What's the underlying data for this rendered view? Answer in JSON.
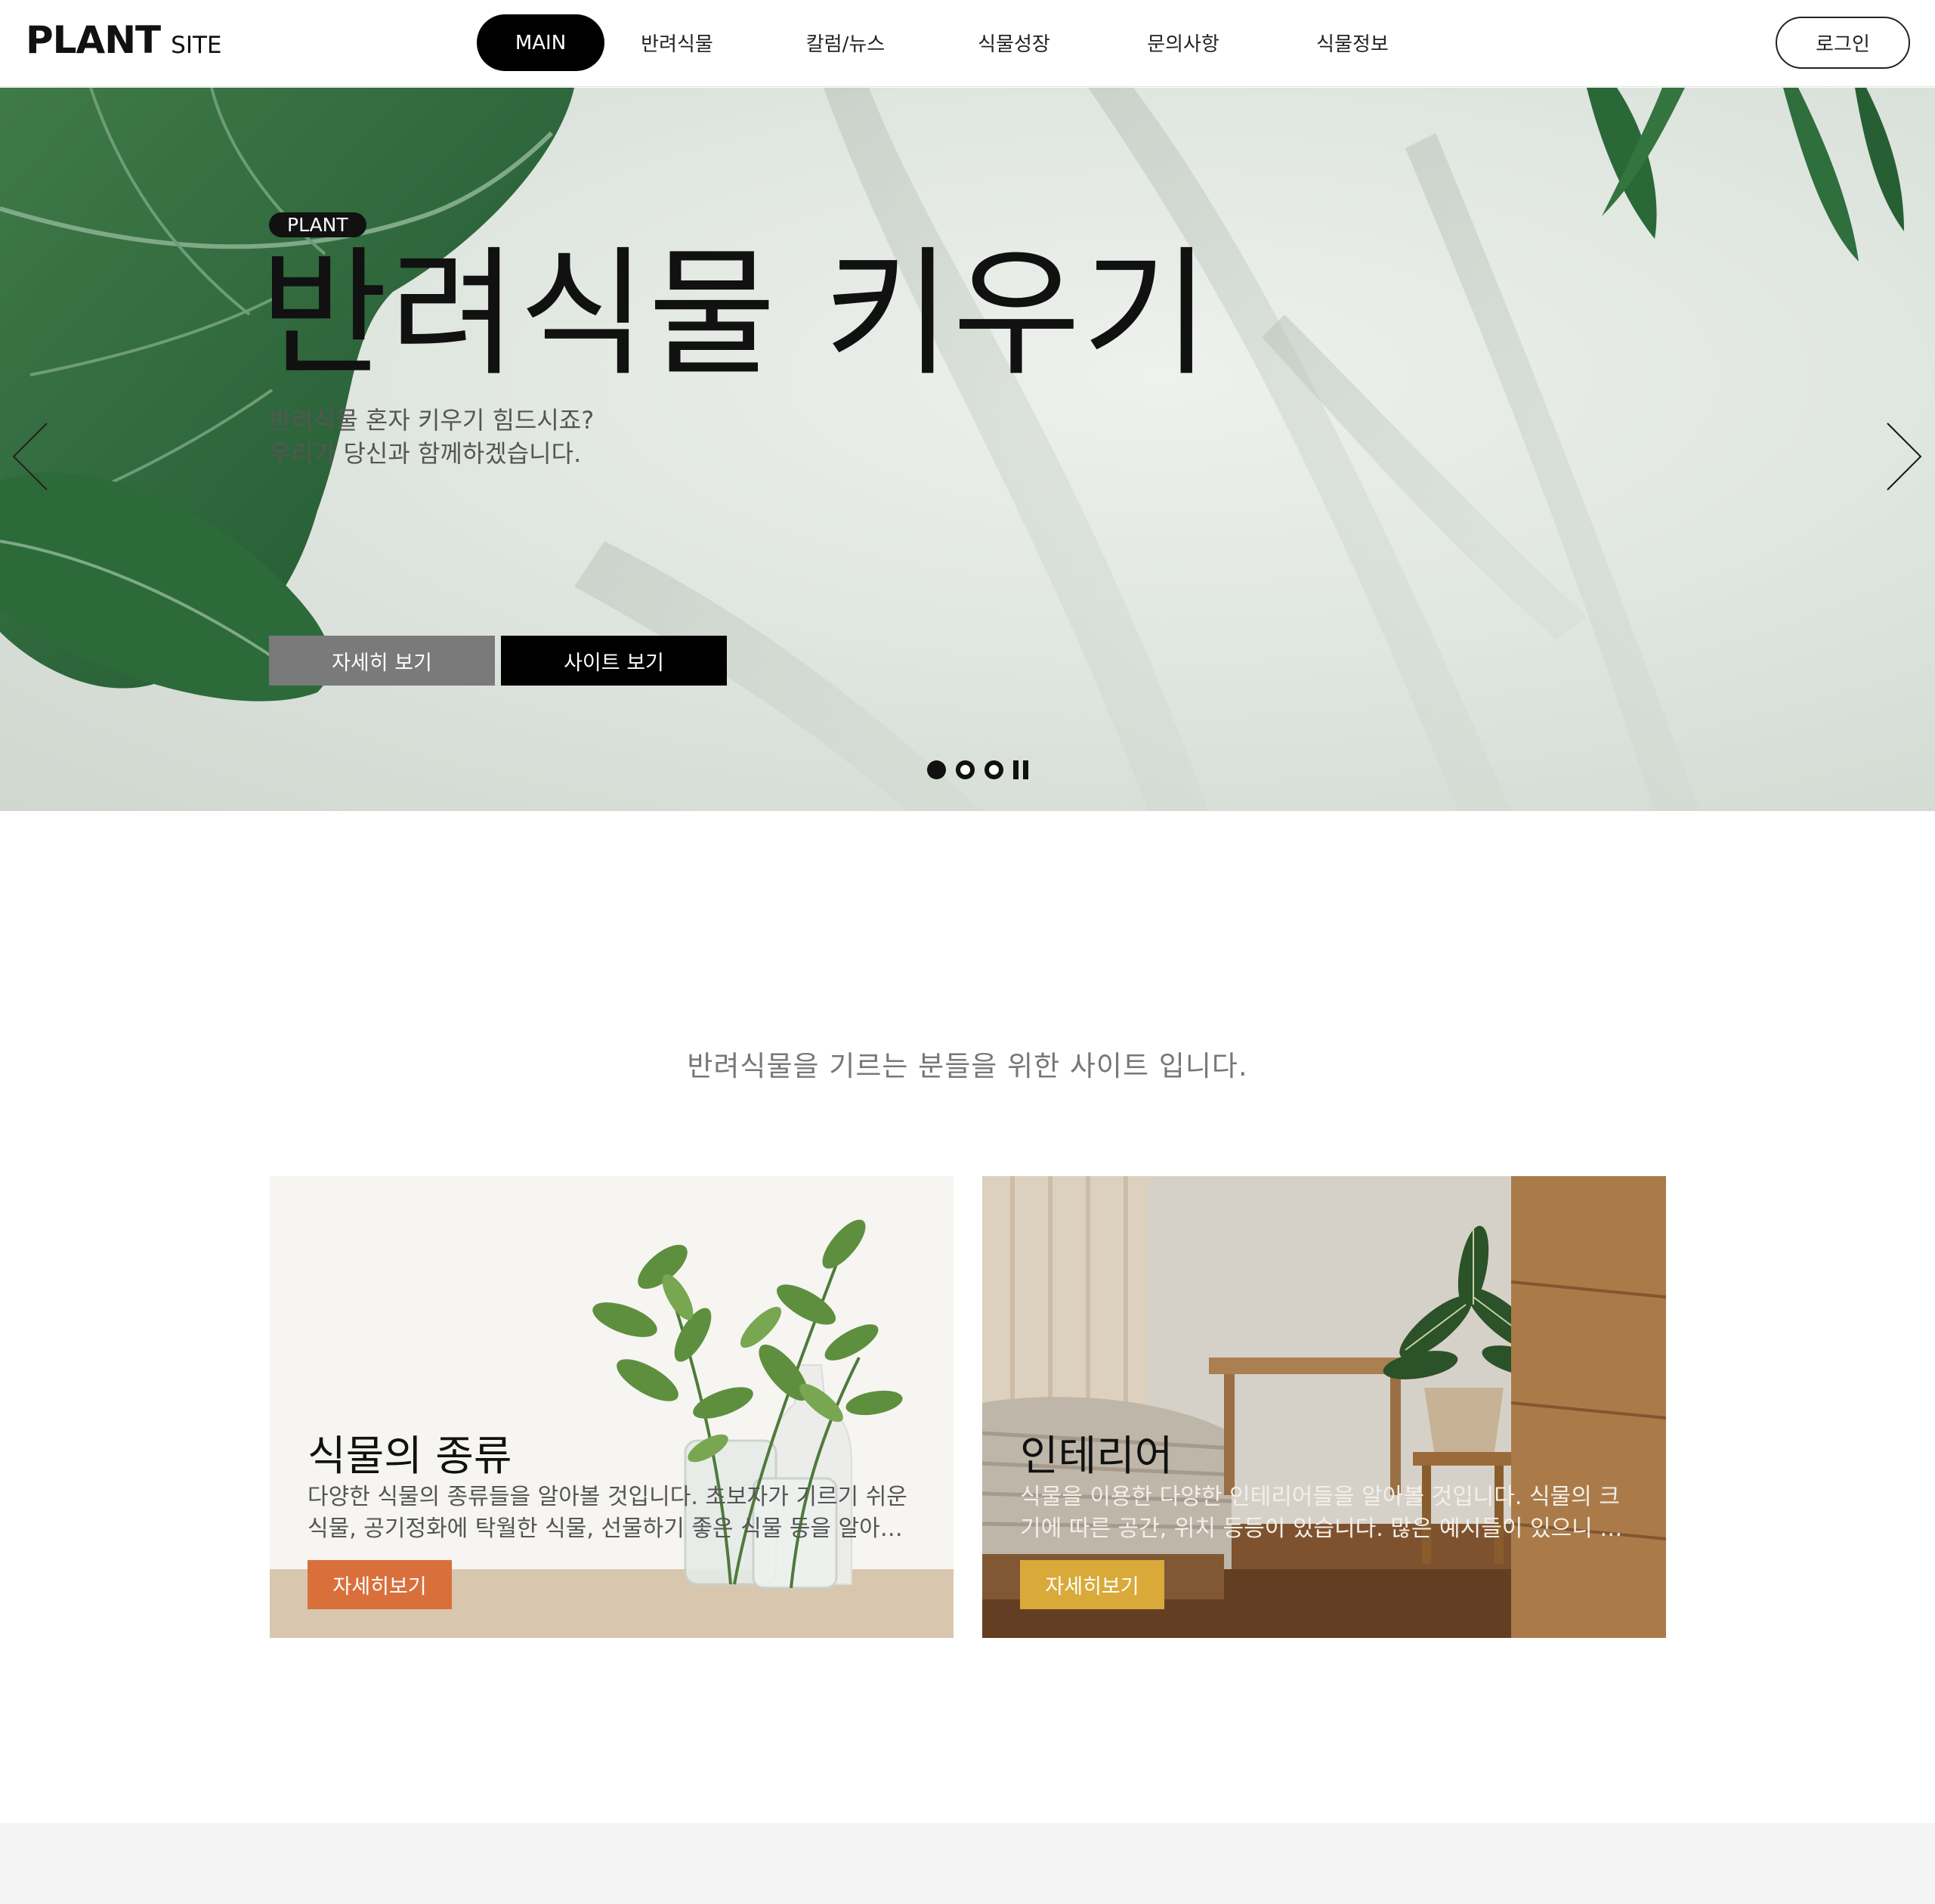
{
  "header": {
    "logo_main": "PLANT",
    "logo_sub": "SITE",
    "nav": [
      {
        "label": "MAIN",
        "active": true
      },
      {
        "label": "반려식물",
        "active": false
      },
      {
        "label": "칼럼/뉴스",
        "active": false
      },
      {
        "label": "식물성장",
        "active": false
      },
      {
        "label": "문의사항",
        "active": false
      },
      {
        "label": "식물정보",
        "active": false
      }
    ],
    "login_label": "로그인"
  },
  "hero": {
    "badge": "PLANT",
    "title": "반려식물 키우기",
    "desc_line1": "반려식물 혼자 키우기 힘드시죠?",
    "desc_line2": "우리가 당신과 함께하겠습니다.",
    "btn_detail": "자세히 보기",
    "btn_site": "사이트 보기",
    "prev_icon": "chevron-left-icon",
    "next_icon": "chevron-right-icon",
    "slide_count": 3,
    "active_slide": 1
  },
  "intro": {
    "text": "반려식물을 기르는 분들을 위한 사이트 입니다."
  },
  "cards": [
    {
      "title": "식물의 종류",
      "desc": "다양한 식물의 종류들을 알아볼 것입니다. 초보자가 기르기 쉬운 식물, 공기정화에 탁월한 식물, 선물하기 좋은 식물 등을 알아볼 수 있습니다.",
      "btn": "자세히보기",
      "btn_color": "#d9703c"
    },
    {
      "title": "인테리어",
      "desc": "식물을 이용한 다양한 인테리어들을 알아볼 것입니다. 식물의 크기에 따른 공간, 위치 등등이 있습니다. 많은 예시들이 있으니 참고해보세요.",
      "btn": "자세히보기",
      "btn_color": "#d9a93a"
    }
  ],
  "colors": {
    "accent_black": "#000000",
    "hero_btn_gray": "#7a7a7a",
    "footer_bg": "#f4f4f4"
  }
}
